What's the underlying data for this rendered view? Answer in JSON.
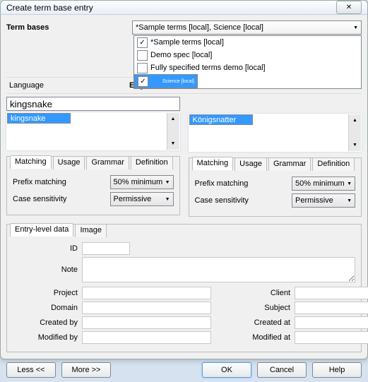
{
  "title": "Create term base entry",
  "term_bases_label": "Term bases",
  "combo_value": "*Sample terms [local], Science [local]",
  "dropdown": [
    {
      "label": "*Sample terms [local]",
      "checked": true,
      "sel": false
    },
    {
      "label": "Demo spec [local]",
      "checked": false,
      "sel": false
    },
    {
      "label": "Fully specified terms demo [local]",
      "checked": false,
      "sel": false
    },
    {
      "label": "Science [local]",
      "checked": true,
      "sel": true
    }
  ],
  "language_label": "Language",
  "language_value": "English",
  "left": {
    "input": "kingsnake",
    "list_item": "kingsnake"
  },
  "right": {
    "list_item": "Königsnatter"
  },
  "tabs": {
    "matching": "Matching",
    "usage": "Usage",
    "grammar": "Grammar",
    "definition": "Definition"
  },
  "prefix_label": "Prefix matching",
  "prefix_value": "50% minimum",
  "case_label": "Case sensitivity",
  "case_value": "Permissive",
  "eld": {
    "tab1": "Entry-level data",
    "tab2": "Image",
    "id": "ID",
    "note": "Note",
    "project": "Project",
    "client": "Client",
    "domain": "Domain",
    "subject": "Subject",
    "created_by": "Created by",
    "created_at": "Created at",
    "modified_by": "Modified by",
    "modified_at": "Modified at"
  },
  "buttons": {
    "less": "Less <<",
    "more": "More >>",
    "ok": "OK",
    "cancel": "Cancel",
    "help": "Help"
  }
}
